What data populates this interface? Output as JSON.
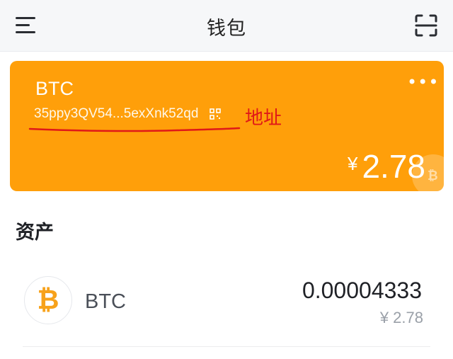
{
  "header": {
    "title": "钱包",
    "menu_icon": "menu-icon",
    "scan_icon": "scan-icon"
  },
  "wallet_card": {
    "coin": "BTC",
    "more_icon": "more-icon",
    "more_label": "•••",
    "address": "35ppy3QV54...5exXnk52qd",
    "qr_icon": "qr-code-icon",
    "annotation": "地址",
    "currency_symbol": "¥",
    "balance": "2.78",
    "bg_color": "#ff9f0a",
    "annotation_color": "#e01818"
  },
  "assets": {
    "title": "资产",
    "items": [
      {
        "icon": "bitcoin-icon",
        "icon_glyph": "₿",
        "name": "BTC",
        "amount": "0.00004333",
        "fiat": "¥ 2.78"
      }
    ]
  }
}
